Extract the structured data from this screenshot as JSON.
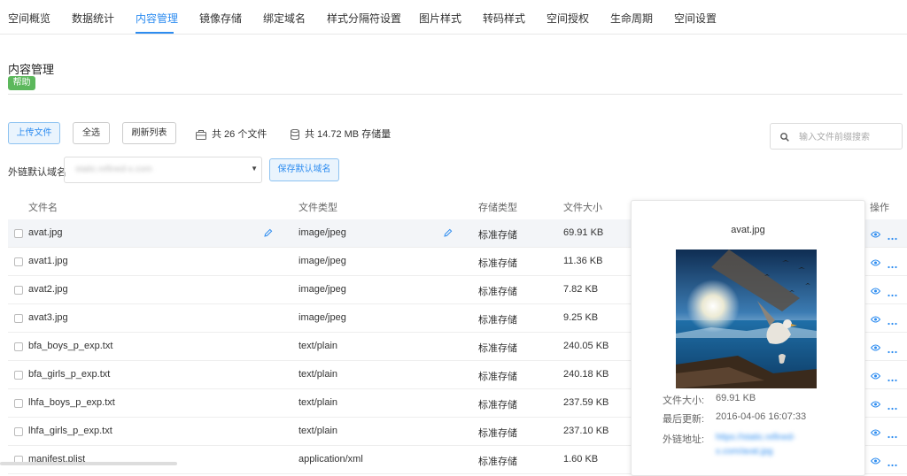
{
  "tabs": [
    {
      "label": "空间概览"
    },
    {
      "label": "数据统计"
    },
    {
      "label": "内容管理",
      "active": true
    },
    {
      "label": "镜像存储"
    },
    {
      "label": "绑定域名"
    },
    {
      "label": "样式分隔符设置"
    },
    {
      "label": "图片样式"
    },
    {
      "label": "转码样式"
    },
    {
      "label": "空间授权"
    },
    {
      "label": "生命周期"
    },
    {
      "label": "空间设置"
    }
  ],
  "page": {
    "title": "内容管理",
    "help_badge": "帮助"
  },
  "toolbar": {
    "upload_label": "上传文件",
    "select_all_label": "全选",
    "refresh_label": "刷新列表",
    "file_count": "共 26 个文件",
    "storage_total": "共 14.72 MB 存储量"
  },
  "search": {
    "placeholder": "输入文件前缀搜索"
  },
  "domain": {
    "label": "外链默认域名",
    "value": "static.refined-x.com",
    "save_label": "保存默认域名"
  },
  "table": {
    "columns": [
      "文件名",
      "文件类型",
      "存储类型",
      "文件大小",
      "操作"
    ],
    "rows": [
      {
        "name": "avat.jpg",
        "type": "image/jpeg",
        "storage": "标准存储",
        "size": "69.91 KB"
      },
      {
        "name": "avat1.jpg",
        "type": "image/jpeg",
        "storage": "标准存储",
        "size": "11.36 KB"
      },
      {
        "name": "avat2.jpg",
        "type": "image/jpeg",
        "storage": "标准存储",
        "size": "7.82 KB"
      },
      {
        "name": "avat3.jpg",
        "type": "image/jpeg",
        "storage": "标准存储",
        "size": "9.25 KB"
      },
      {
        "name": "bfa_boys_p_exp.txt",
        "type": "text/plain",
        "storage": "标准存储",
        "size": "240.05 KB"
      },
      {
        "name": "bfa_girls_p_exp.txt",
        "type": "text/plain",
        "storage": "标准存储",
        "size": "240.18 KB"
      },
      {
        "name": "lhfa_boys_p_exp.txt",
        "type": "text/plain",
        "storage": "标准存储",
        "size": "237.59 KB"
      },
      {
        "name": "lhfa_girls_p_exp.txt",
        "type": "text/plain",
        "storage": "标准存储",
        "size": "237.10 KB"
      },
      {
        "name": "manifest.plist",
        "type": "application/xml",
        "storage": "标准存储",
        "size": "1.60 KB"
      }
    ]
  },
  "popover": {
    "title": "avat.jpg",
    "size_label": "文件大小:",
    "size_value": "69.91 KB",
    "updated_label": "最后更新:",
    "updated_value": "2016-04-06 16:07:33",
    "link_label": "外链地址:",
    "link_value": "https://static.refined-x.com/avat.jpg"
  },
  "colors": {
    "accent": "#2d8cf0",
    "help_badge": "#5cb85c",
    "row_hover": "#f3f5f8"
  },
  "icons": [
    "pencil-icon",
    "eye-icon",
    "more-icon",
    "search-icon",
    "briefcase-icon",
    "database-icon",
    "chevron-down-icon"
  ]
}
